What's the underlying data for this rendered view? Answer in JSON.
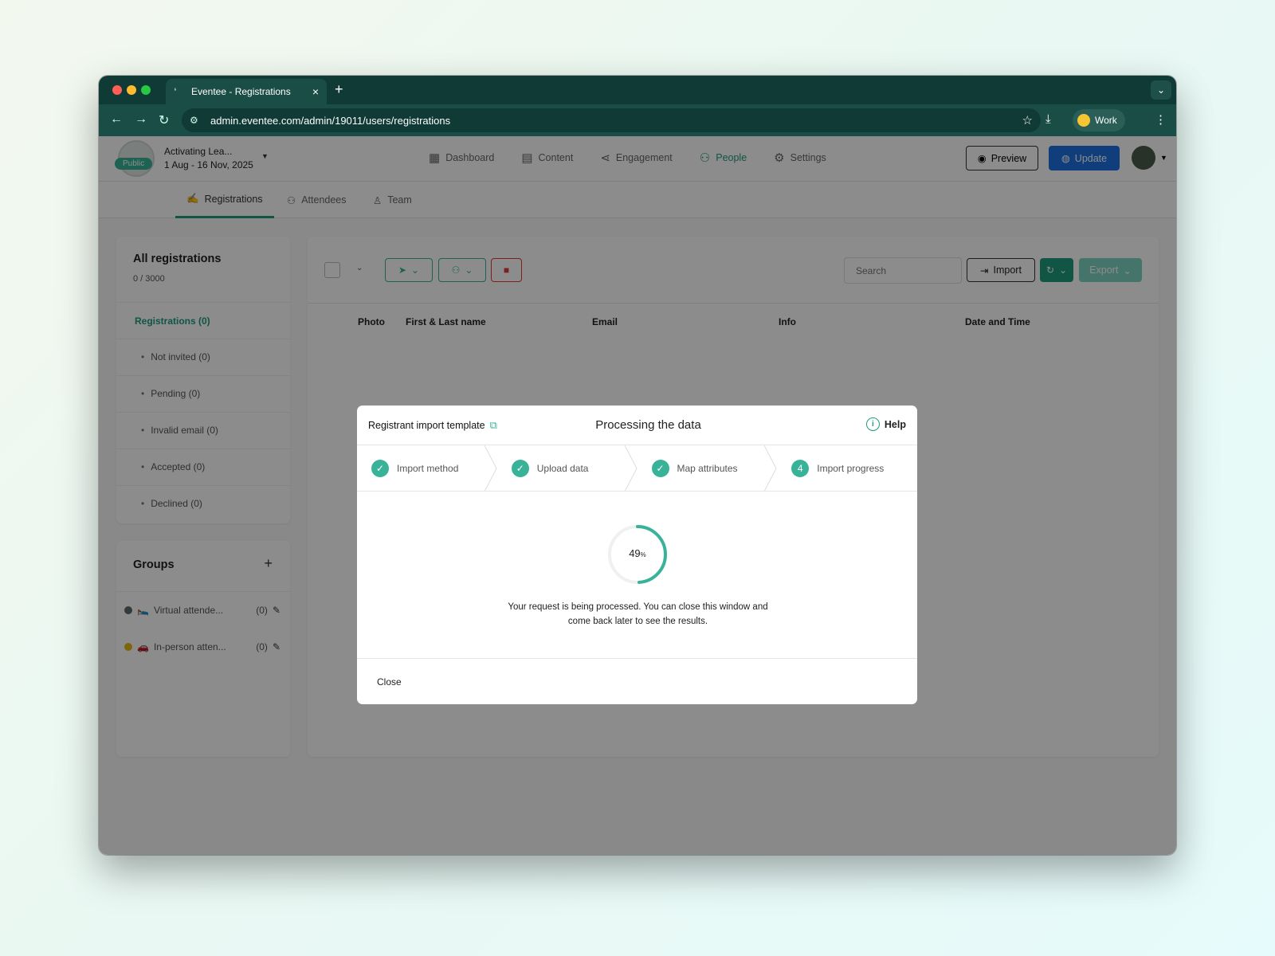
{
  "browser": {
    "tab_title": "Eventee - Registrations",
    "url": "admin.eventee.com/admin/19011/users/registrations",
    "profile": "Work"
  },
  "header": {
    "event_name": "Activating Lea...",
    "event_dates": "1 Aug - 16 Nov, 2025",
    "public_badge": "Public",
    "nav": [
      {
        "label": "Dashboard",
        "icon": "dashboard-icon"
      },
      {
        "label": "Content",
        "icon": "calendar-icon"
      },
      {
        "label": "Engagement",
        "icon": "share-icon"
      },
      {
        "label": "People",
        "icon": "people-icon"
      },
      {
        "label": "Settings",
        "icon": "gear-icon"
      }
    ],
    "preview_label": "Preview",
    "update_label": "Update"
  },
  "subnav": {
    "tabs": [
      "Registrations",
      "Attendees",
      "Team"
    ]
  },
  "sidebar": {
    "all_title": "All registrations",
    "all_count": "0 / 3000",
    "registrations_label": "Registrations (0)",
    "statuses": [
      "Not invited (0)",
      "Pending (0)",
      "Invalid email (0)",
      "Accepted (0)",
      "Declined (0)"
    ],
    "groups_title": "Groups",
    "groups": [
      {
        "name": "Virtual attende...",
        "count": "(0)",
        "emoji": "🛌",
        "color": "#5f6b68"
      },
      {
        "name": "In-person atten...",
        "count": "(0)",
        "emoji": "🚗",
        "color": "#e4b812"
      }
    ]
  },
  "content": {
    "search_placeholder": "Search",
    "import_label": "Import",
    "export_label": "Export",
    "columns": [
      "Photo",
      "First & Last name",
      "Email",
      "Info",
      "Date and Time"
    ]
  },
  "modal": {
    "template_link": "Registrant import template",
    "title": "Processing the data",
    "help": "Help",
    "steps": [
      {
        "label": "Import method",
        "state": "done"
      },
      {
        "label": "Upload data",
        "state": "done"
      },
      {
        "label": "Map attributes",
        "state": "done"
      },
      {
        "label": "Import progress",
        "state": "current",
        "number": "4"
      }
    ],
    "progress_percent": 49,
    "progress_value": "49",
    "progress_unit": "%",
    "message": "Your request is being processed. You can close this window and come back later to see the results.",
    "close_label": "Close"
  },
  "colors": {
    "accent": "#1f9b7e",
    "accent_light": "#38b39a",
    "update_blue": "#1e6fe0",
    "danger": "#e03a3a",
    "browser_dark": "#0f3a35"
  }
}
